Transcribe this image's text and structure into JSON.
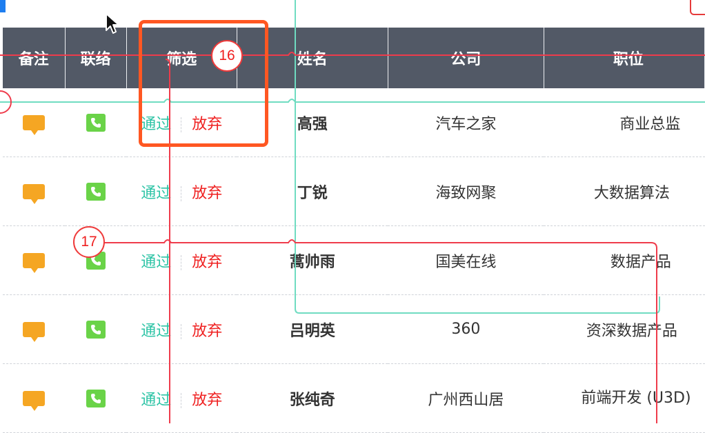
{
  "table": {
    "headers": [
      "备注",
      "联络",
      "筛选",
      "姓名",
      "公司",
      "职位"
    ],
    "actions": {
      "pass": "通过",
      "drop": "放弃"
    },
    "rows": [
      {
        "name": "高强",
        "company": "汽车之家",
        "position": "商业总监"
      },
      {
        "name": "丁锐",
        "company": "海致网聚",
        "position": "大数据算法"
      },
      {
        "name": "蒿帅雨",
        "company": "国美在线",
        "position": "数据产品"
      },
      {
        "name": "吕明英",
        "company": "360",
        "position": "资深数据产品"
      },
      {
        "name": "张纯奇",
        "company": "广州西山居",
        "position": "前端开发 (U3D)"
      }
    ]
  },
  "annotations": {
    "badge_16": "16",
    "badge_17": "17"
  },
  "colors": {
    "header_bg": "#525966",
    "pass": "#2ec4a6",
    "drop": "#ef2020",
    "note_icon": "#f5a623",
    "phone_icon": "#6ad348",
    "highlight": "#ff5722",
    "line_red": "#ef3b4b",
    "line_teal": "#6fdcc1"
  },
  "icons": {
    "note": "comment-icon",
    "contact": "phone-icon",
    "cursor": "mouse-pointer-icon"
  }
}
